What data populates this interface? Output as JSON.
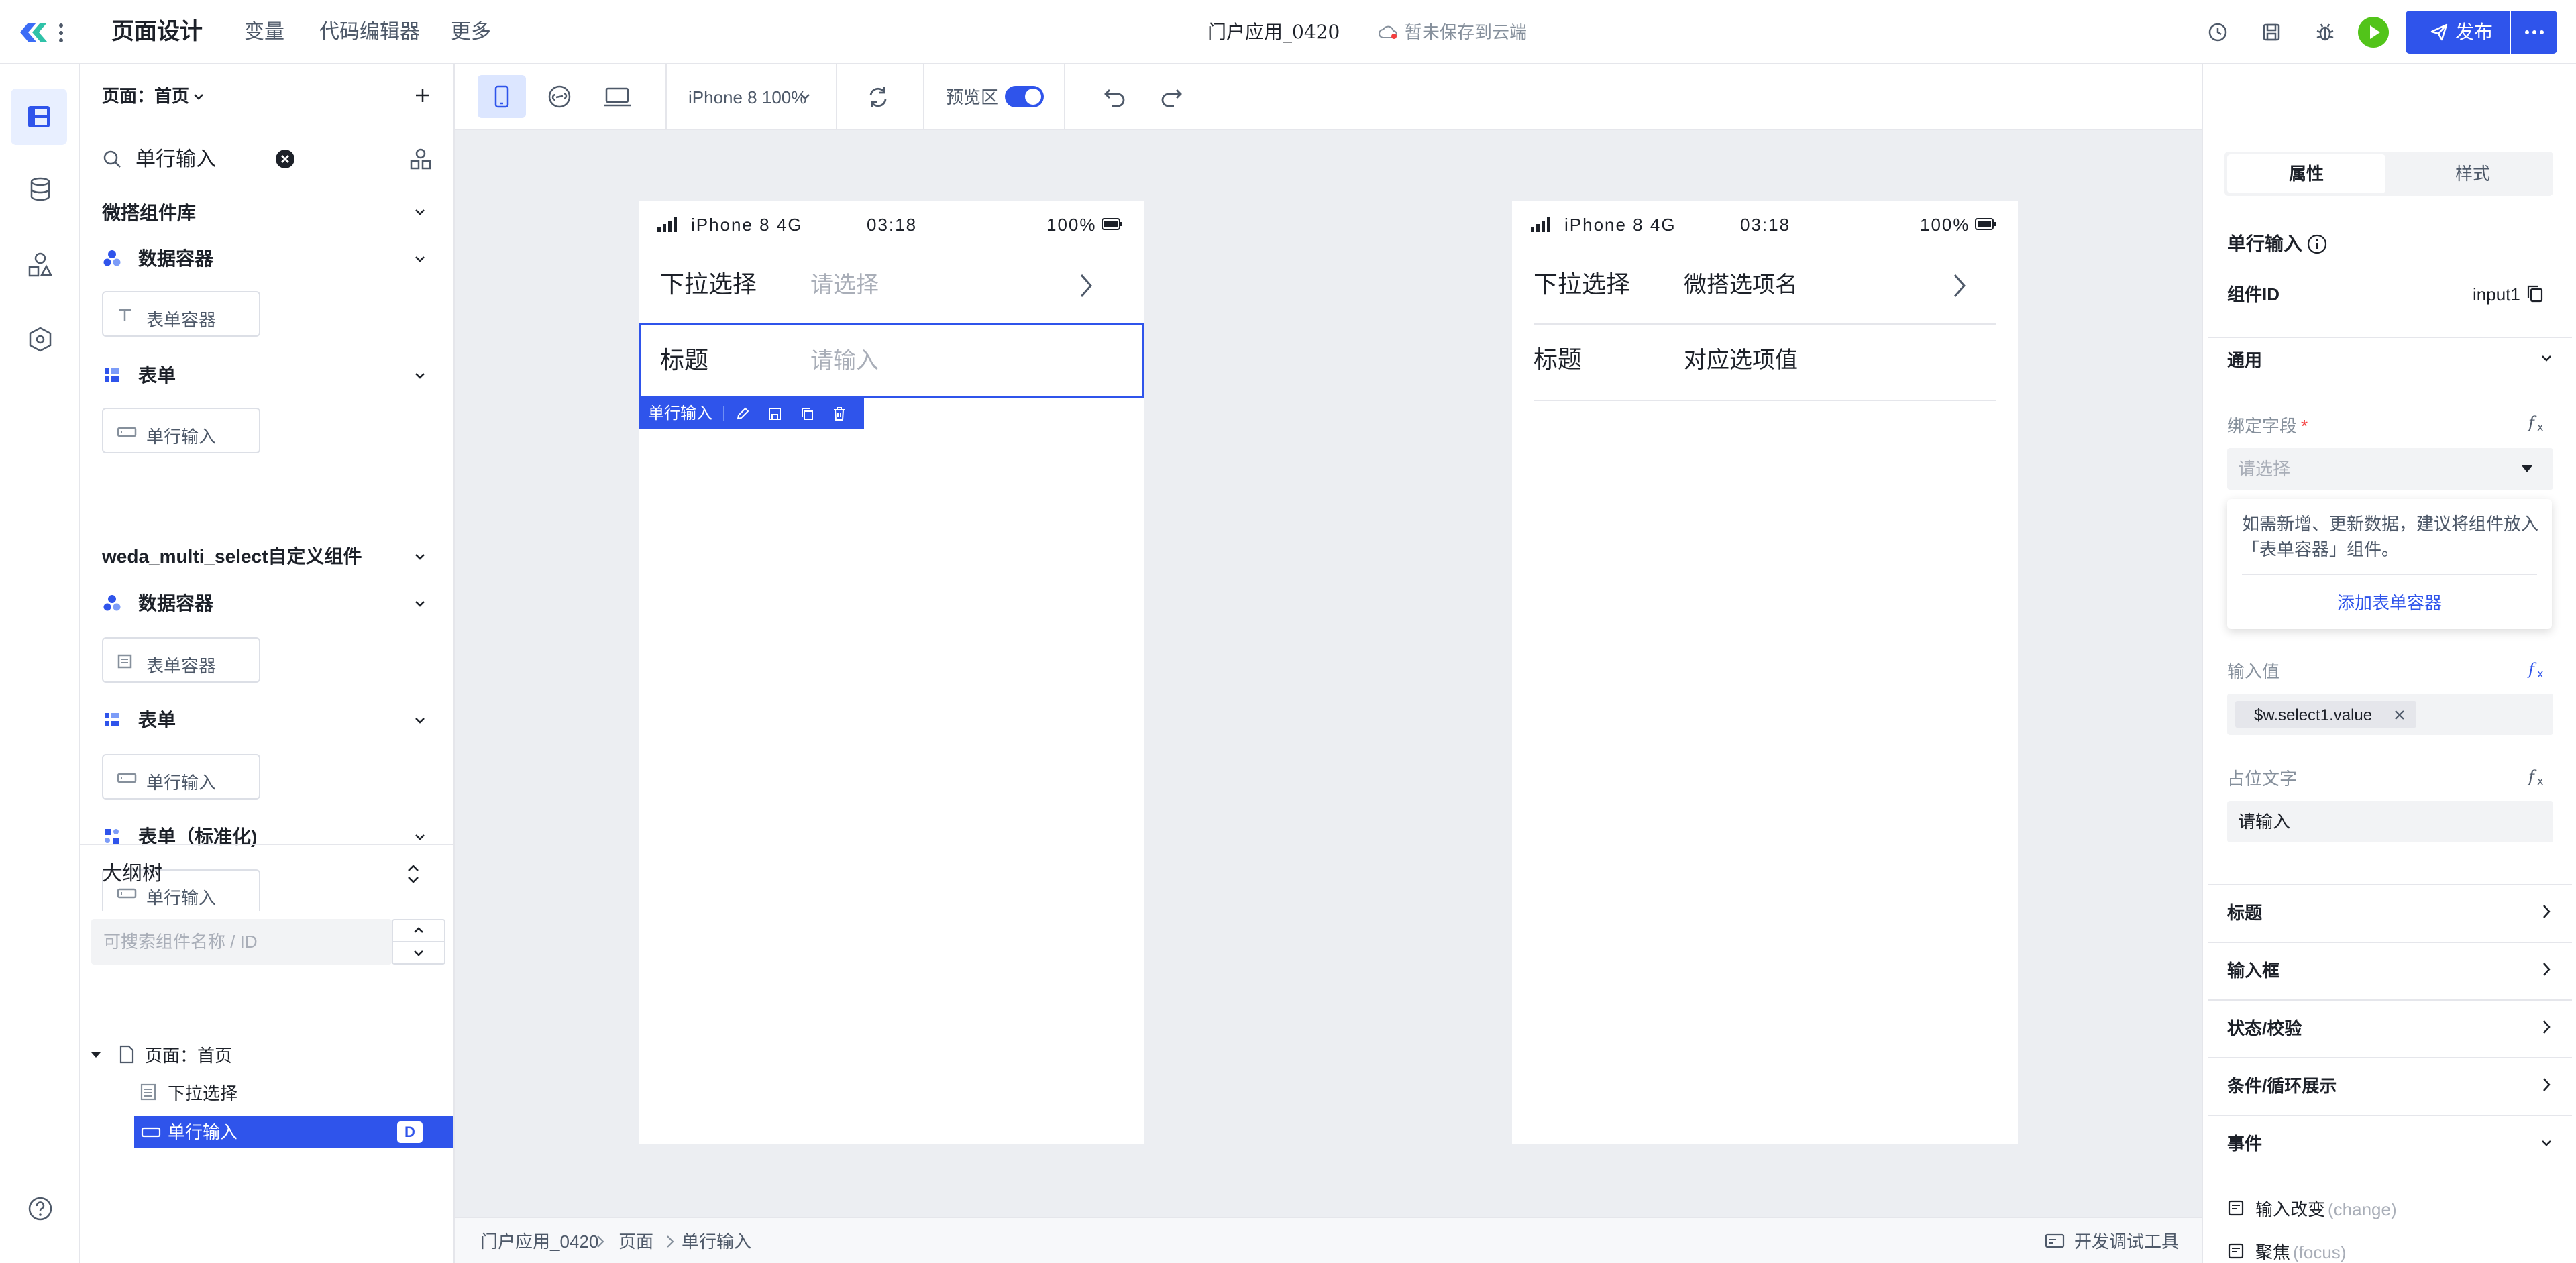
{
  "header": {
    "title": "页面设计",
    "nav": [
      "变量",
      "代码编辑器",
      "更多"
    ],
    "app_name": "门户应用_0420",
    "save_status": "暂未保存到云端",
    "publish_label": "发布"
  },
  "left_panel": {
    "page_selector": "页面：首页",
    "search_value": "单行输入",
    "groups": [
      {
        "title": "微搭组件库"
      },
      {
        "title": "weda_multi_select自定义组件"
      }
    ],
    "lib1": {
      "container_group": "数据容器",
      "container_item": "表单容器",
      "form_group": "表单",
      "form_item": "单行输入"
    },
    "lib2": {
      "container_group": "数据容器",
      "container_item": "表单容器",
      "form_group": "表单",
      "form_item": "单行输入",
      "std_group": "表单（标准化)",
      "std_item": "单行输入"
    },
    "outline": {
      "title": "大纲树",
      "search_placeholder": "可搜索组件名称 / ID",
      "root": "页面：首页",
      "child1": "下拉选择",
      "child2": "单行输入",
      "child2_badge": "D"
    }
  },
  "toolbar": {
    "device": "iPhone 8 100%",
    "preview_label": "预览区"
  },
  "phone_left": {
    "status_device": "iPhone 8  4G",
    "status_time": "03:18",
    "status_battery": "100%",
    "row1_label": "下拉选择",
    "row1_placeholder": "请选择",
    "row2_label": "标题",
    "row2_placeholder": "请输入",
    "selection_tag": "单行输入"
  },
  "phone_right": {
    "status_device": "iPhone 8  4G",
    "status_time": "03:18",
    "status_battery": "100%",
    "row1_label": "下拉选择",
    "row1_value": "微搭选项名",
    "row2_label": "标题",
    "row2_value": "对应选项值"
  },
  "breadcrumb": [
    "门户应用_0420",
    "页面",
    "单行输入"
  ],
  "devtools_label": "开发调试工具",
  "right_panel": {
    "tabs": [
      "属性",
      "样式"
    ],
    "component_title": "单行输入",
    "component_id_label": "组件ID",
    "component_id_value": "input1",
    "general_section": "通用",
    "bind_field_label": "绑定字段",
    "bind_field_placeholder": "请选择",
    "tip_text_line1": "如需新增、更新数据，建议将组件放入",
    "tip_text_line2": "「表单容器」组件。",
    "tip_link": "添加表单容器",
    "input_value_label": "输入值",
    "input_value_tag": "$w.select1.value",
    "placeholder_label": "占位文字",
    "placeholder_value": "请输入",
    "sections": [
      "标题",
      "输入框",
      "状态/校验",
      "条件/循环展示"
    ],
    "events_section": "事件",
    "event1": "输入改变",
    "event1_code": "(change)",
    "event2": "聚焦",
    "event2_code": "(focus)"
  },
  "colors": {
    "primary": "#2f54eb",
    "run_green": "#52c41a"
  }
}
